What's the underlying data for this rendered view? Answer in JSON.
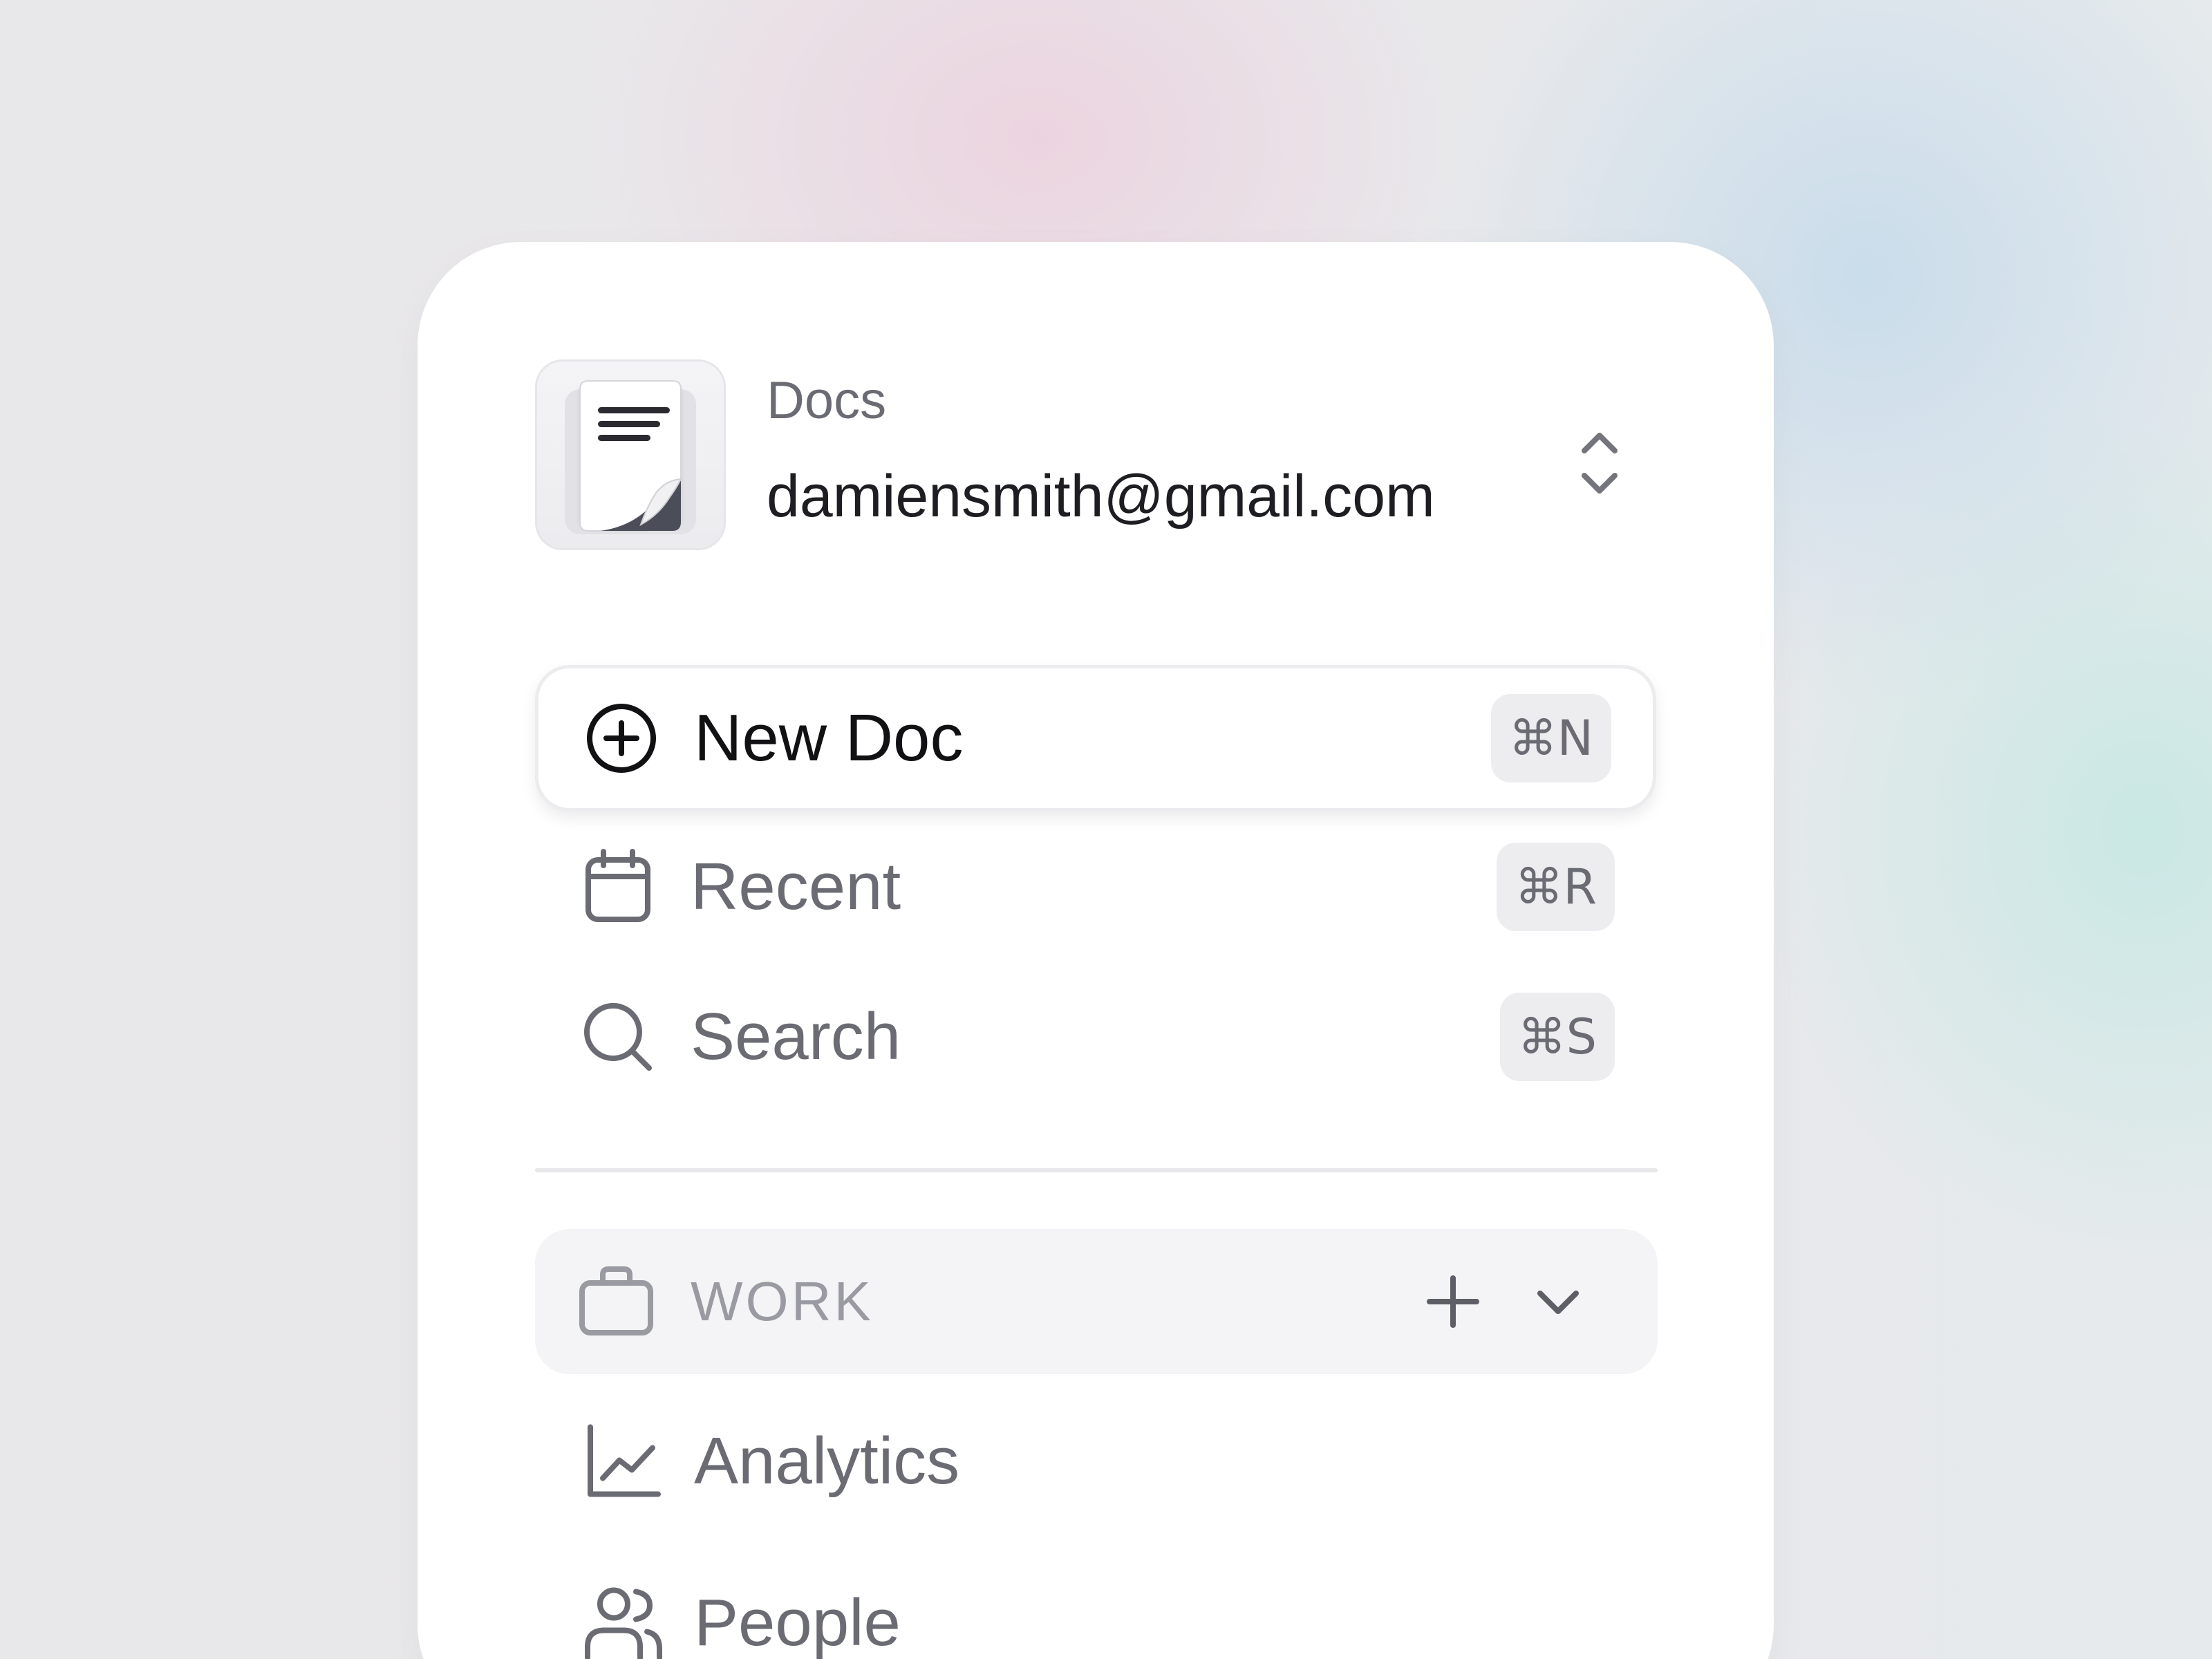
{
  "header": {
    "app_name": "Docs",
    "account_email": "damiensmith@gmail.com",
    "app_icon": "document-icon",
    "switcher_icon": "chevron-up-down-icon"
  },
  "nav": {
    "items": [
      {
        "label": "New Doc",
        "shortcut": "⌘N",
        "icon": "plus-circle-icon",
        "active": true
      },
      {
        "label": "Recent",
        "shortcut": "⌘R",
        "icon": "calendar-icon",
        "active": false
      },
      {
        "label": "Search",
        "shortcut": "⌘S",
        "icon": "search-icon",
        "active": false
      }
    ]
  },
  "section": {
    "label": "WORK",
    "icon": "briefcase-icon",
    "expanded": true,
    "items": [
      {
        "label": "Analytics",
        "icon": "chart-line-icon"
      },
      {
        "label": "People",
        "icon": "users-icon"
      }
    ]
  },
  "colors": {
    "card_background": "#ffffff",
    "text_primary": "#111114",
    "text_secondary": "#6b6b74",
    "text_muted": "#9a9aa2",
    "kbd_background": "#ededf0",
    "section_background": "#f4f4f6"
  }
}
